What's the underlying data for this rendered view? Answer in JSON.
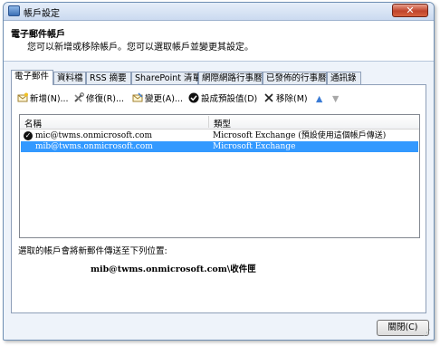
{
  "window": {
    "title": "帳戶設定"
  },
  "header": {
    "title": "電子郵件帳戶",
    "subtitle": "您可以新增或移除帳戶。您可以選取帳戶並變更其設定。"
  },
  "tabs": [
    {
      "label": "電子郵件",
      "active": true
    },
    {
      "label": "資料檔"
    },
    {
      "label": "RSS 摘要"
    },
    {
      "label": "SharePoint 清單"
    },
    {
      "label": "網際網路行事曆"
    },
    {
      "label": "已發佈的行事曆"
    },
    {
      "label": "通訊錄"
    }
  ],
  "toolbar": {
    "new": "新增(N)...",
    "repair": "修復(R)...",
    "change": "變更(A)...",
    "set_default": "設成預設值(D)",
    "remove": "移除(M)"
  },
  "list": {
    "columns": {
      "name": "名稱",
      "type": "類型"
    },
    "rows": [
      {
        "name": "mic@twms.onmicrosoft.com",
        "type": "Microsoft Exchange (預設使用這個帳戶傳送)",
        "is_default": true
      },
      {
        "name": "mib@twms.onmicrosoft.com",
        "type": "Microsoft Exchange",
        "selected": true
      }
    ]
  },
  "delivery": {
    "label": "選取的帳戶會將新郵件傳送至下列位置:",
    "location": "mib@twms.onmicrosoft.com\\收件匣"
  },
  "buttons": {
    "close": "關閉(C)"
  },
  "colors": {
    "selection": "#3399ff",
    "close_button": "#c0442b"
  }
}
